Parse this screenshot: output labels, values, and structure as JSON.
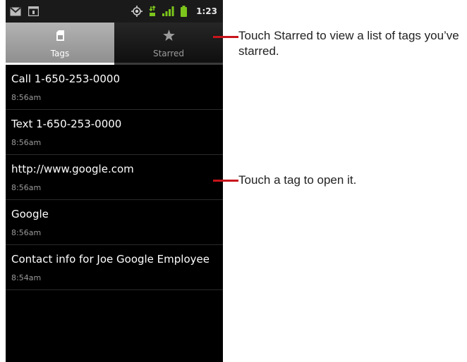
{
  "status_bar": {
    "time": "1:23",
    "icons": [
      "gmail-icon",
      "calendar-icon",
      "gps-icon",
      "data-3g-icon",
      "signal-icon",
      "battery-icon"
    ]
  },
  "tabs": [
    {
      "label": "Tags",
      "icon": "tag-icon",
      "selected": true
    },
    {
      "label": "Starred",
      "icon": "star-icon",
      "selected": false
    }
  ],
  "tags": [
    {
      "title": "Call 1-650-253-0000",
      "time": "8:56am"
    },
    {
      "title": "Text 1-650-253-0000",
      "time": "8:56am"
    },
    {
      "title": "http://www.google.com",
      "time": "8:56am"
    },
    {
      "title": "Google",
      "time": "8:56am"
    },
    {
      "title": "Contact info for Joe Google Employee",
      "time": "8:54am"
    }
  ],
  "annotations": {
    "starred_note": "Touch Starred to view a list of tags you’ve starred.",
    "tag_note": "Touch a tag to open it."
  },
  "colors": {
    "callout": "#c8141b",
    "screen_background": "#000000",
    "tab_selected": "#a6a6a6"
  }
}
